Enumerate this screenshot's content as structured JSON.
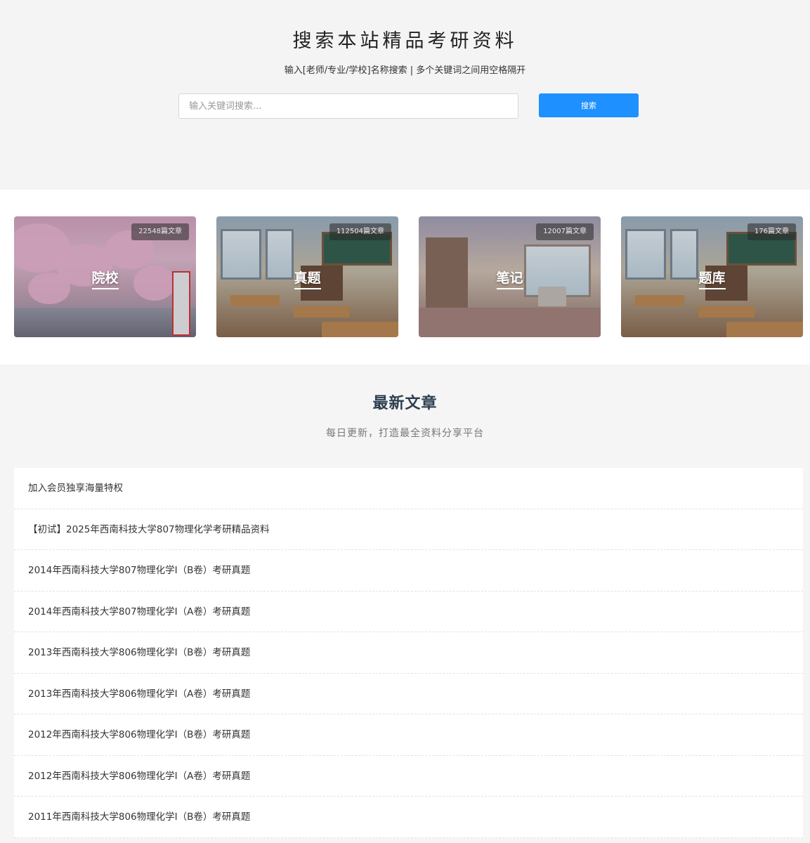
{
  "hero": {
    "title": "搜索本站精品考研资料",
    "subtitle": "输入[老师/专业/学校]名称搜索 | 多个关键词之间用空格隔开",
    "search_placeholder": "输入关键词搜索...",
    "search_button": "搜索",
    "accent_color": "#1e90ff"
  },
  "categories": [
    {
      "label": "院校",
      "count": "22548篇文章"
    },
    {
      "label": "真题",
      "count": "112504篇文章"
    },
    {
      "label": "笔记",
      "count": "12007篇文章"
    },
    {
      "label": "题库",
      "count": "176篇文章"
    }
  ],
  "latest": {
    "title": "最新文章",
    "subtitle": "每日更新，打造最全资料分享平台",
    "items": [
      "加入会员独享海量特权",
      "【初试】2025年西南科技大学807物理化学考研精品资料",
      "2014年西南科技大学807物理化学Ⅰ（B卷）考研真题",
      "2014年西南科技大学807物理化学Ⅰ（A卷）考研真题",
      "2013年西南科技大学806物理化学Ⅰ（B卷）考研真题",
      "2013年西南科技大学806物理化学Ⅰ（A卷）考研真题",
      "2012年西南科技大学806物理化学Ⅰ（B卷）考研真题",
      "2012年西南科技大学806物理化学Ⅰ（A卷）考研真题",
      "2011年西南科技大学806物理化学Ⅰ（B卷）考研真题"
    ]
  }
}
